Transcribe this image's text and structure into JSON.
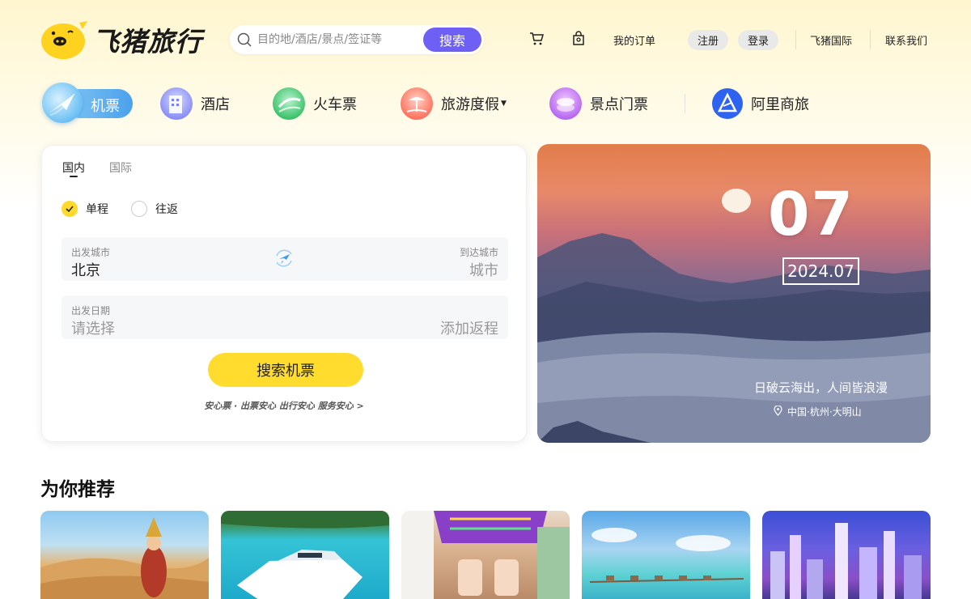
{
  "brand": {
    "name": "飞猪旅行"
  },
  "search": {
    "placeholder": "目的地/酒店/景点/签证等",
    "button": "搜索"
  },
  "header_links": {
    "orders": "我的订单",
    "register": "注册",
    "login": "登录",
    "international": "飞猪国际",
    "contact": "联系我们"
  },
  "nav": [
    {
      "label": "机票",
      "icon": "plane-icon",
      "active": true
    },
    {
      "label": "酒店",
      "icon": "hotel-icon"
    },
    {
      "label": "火车票",
      "icon": "train-icon"
    },
    {
      "label": "旅游度假",
      "icon": "beach-icon",
      "has_dropdown": true
    },
    {
      "label": "景点门票",
      "icon": "ticket-icon"
    },
    {
      "label": "阿里商旅",
      "icon": "alitrip-icon"
    }
  ],
  "booking": {
    "tabs": [
      "国内",
      "国际"
    ],
    "trip_types": [
      "单程",
      "往返"
    ],
    "selected_trip": "单程",
    "depart_label": "出发城市",
    "depart_value": "北京",
    "arrive_label": "到达城市",
    "arrive_placeholder": "城市",
    "date_label": "出发日期",
    "date_placeholder": "请选择",
    "return_link": "添加返程",
    "cta": "搜索机票",
    "assurance": "安心票 · 出票安心 出行安心 服务安心 >"
  },
  "banner": {
    "day": "07",
    "date": "2024.07",
    "caption": "日破云海出，人间皆浪漫",
    "location": "中国·杭州·大明山"
  },
  "recommend": {
    "title": "为你推荐",
    "tiles": [
      "desert-photo",
      "yacht-photo",
      "van-photo",
      "island-photo",
      "city-photo"
    ]
  },
  "colors": {
    "accent_yellow": "#ffdc2d",
    "search_purple": "#6e5ff5",
    "nav_blue": "#4aa1ec"
  }
}
